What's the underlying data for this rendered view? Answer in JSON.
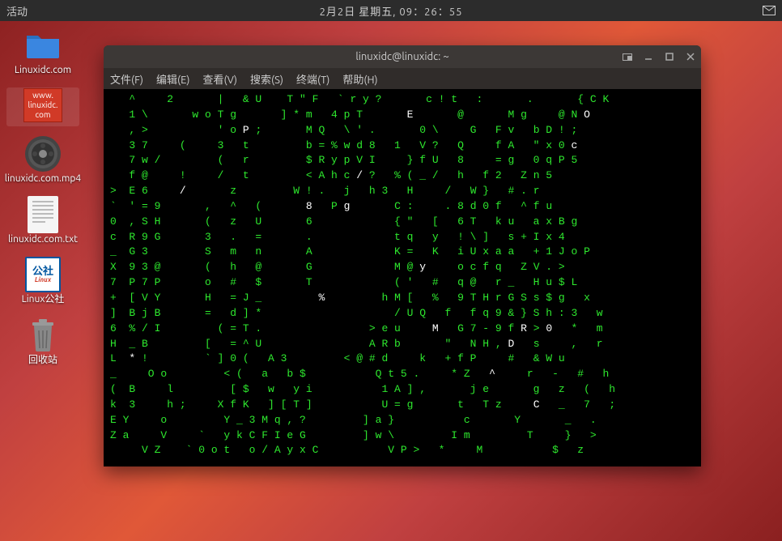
{
  "topbar": {
    "activities": "活动",
    "datetime": "2月2日 星期五, 09：26：55"
  },
  "desktop_icons": [
    {
      "type": "folder",
      "label": "Linuxidc.com",
      "selected": false
    },
    {
      "type": "web",
      "label": "",
      "tile_text": "www.\nlinuxidc.\ncom",
      "selected": true
    },
    {
      "type": "video",
      "label": "linuxidc.com.mp4",
      "selected": false
    },
    {
      "type": "text",
      "label": "linuxidc.com.txt",
      "selected": false
    },
    {
      "type": "logo",
      "label": "Linux公社",
      "tile_text": "公社",
      "selected": false
    },
    {
      "type": "trash",
      "label": "回收站",
      "selected": false
    }
  ],
  "terminal": {
    "title": "linuxidc@linuxidc: ~",
    "menus": [
      "文件(F)",
      "编辑(E)",
      "查看(V)",
      "搜索(S)",
      "终端(T)",
      "帮助(H)"
    ],
    "colors": {
      "fg": "#2ee82e",
      "bright": "#ffffff",
      "dim": "#1a6b1a",
      "bg": "#000000"
    },
    "matrix_lines": [
      "   ^     2       |   & U    T \" F   ` r y ?       c ! t   :       .       { C K",
      "   1 \\       w o T g       ] * m   4 p T       {E}       @       M g     @ N {O}",
      "   , >           ' o {P} ;       M Q   \\ ' .       0 \\     G   F v   b D ! ;",
      "   3 7     (     3   t         b = % w d 8   1   V ?   Q     f A   \" x 0 {c}",
      "   7 w /         (   r         $ R y p V I     } f U   8     = g   0 q P 5",
      "   f @     !     /   t         < A h c {/} ?   % ( _ /   h   f 2   Z n 5",
      ">  E 6     {/}       z         W ! .   j   h 3   H     /   W }   # . r",
      "`  ' = 9       ,   ^   (       {8}   P {g}       C :     . 8 d 0 f   ^ f u",
      "0  , S H       (   z   U       6             { \"   [   6 T   k u   a x B g",
      "c  R 9 G       3   .   =       .             t q   y   ! \\ ]   s + I x 4",
      "_  G 3         S   m   n       A             K =   K   i U x a a   + 1 J o P",
      "X  9 3 @       (   h   @       G             M @ {y}     o c f q   Z V . >",
      "7  P 7 P       o   #   $       T             ( '   #   q @   r _   H u $ L",
      "+  [ V Y       H   = J _         {%}         h M [   %   9 T H r G S s $ g   x",
      "]  B j B       =   d ] *                     / U Q   f   f q 9 & } S h : 3   w",
      "6  % / I         ( = T .                 > e u     {M}   G 7 - 9 f {R} > {0}   *   m",
      "H  _ B         [   = ^ U                 A R b       \"   N H , {D}   s     ,   r",
      "L  {*} !         ` ] 0 (   A 3         < @ # d     k   + f P     #   & W u",
      "_     O o         < (   a   b $           Q t 5 .     * Z   {^}     r   -   #   h",
      "(  B     l         [ $   w   y i           1 A ] ,       j e       g   z   (   h",
      "k  3     h ;     X f K   ] [ T ]           U = g       t   T z     {C}   _   7   ;",
      "E Y     o         Y _ 3 M q , ?         ] a }           c       Y       _   .",
      "Z a     V     `   y k C F I e G         ] w \\         I m         T     }   >",
      "{{{     V Z    ` 0 o t   o / A y x C           V P >   *     M           $   z"
    ]
  }
}
